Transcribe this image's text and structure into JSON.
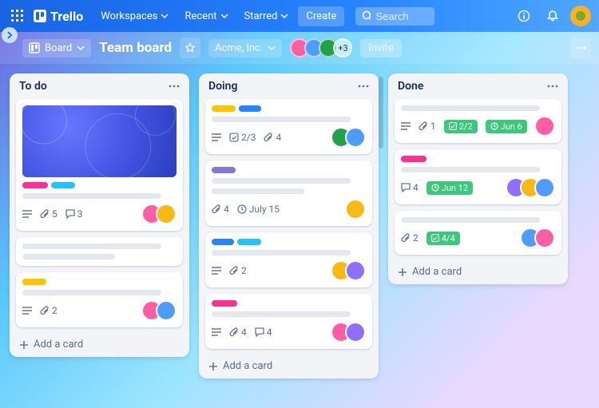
{
  "brand": "Trello",
  "nav": {
    "workspaces": "Workspaces",
    "recent": "Recent",
    "starred": "Starred",
    "create": "Create"
  },
  "search": {
    "placeholder": "Search"
  },
  "board": {
    "view_label": "Board",
    "title": "Team board",
    "workspace": "Acme, Inc.",
    "extra_members": "+3",
    "invite": "Invite"
  },
  "lists": {
    "todo": {
      "title": "To do",
      "card1": {
        "attachments": "5",
        "comments": "3"
      },
      "card2": {
        "attachments": "2"
      },
      "add": "Add a card"
    },
    "doing": {
      "title": "Doing",
      "card1": {
        "checklist": "2/3",
        "attachments": "4"
      },
      "card2": {
        "attachments": "4",
        "due": "July 15"
      },
      "card3": {
        "attachments": "2"
      },
      "card4": {
        "attachments": "4",
        "comments": "4"
      },
      "add": "Add a card"
    },
    "done": {
      "title": "Done",
      "card1": {
        "attachments": "1",
        "checklist": "2/2",
        "due": "Jun 6"
      },
      "card2": {
        "comments": "4",
        "due": "Jun 12"
      },
      "card3": {
        "attachments": "2",
        "checklist": "4/4"
      },
      "add": "Add a card"
    }
  }
}
